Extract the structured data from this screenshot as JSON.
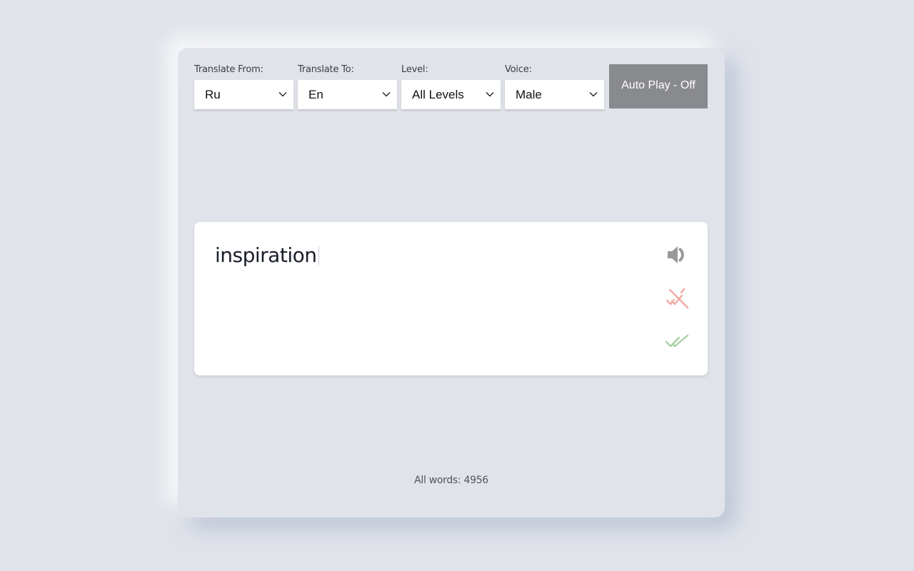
{
  "controls": {
    "from": {
      "label": "Translate From:",
      "value": "Ru"
    },
    "to": {
      "label": "Translate To:",
      "value": "En"
    },
    "level": {
      "label": "Level:",
      "value": "All Levels"
    },
    "voice": {
      "label": "Voice:",
      "value": "Male"
    },
    "autoplay_label": "Auto Play - Off"
  },
  "card": {
    "word": "inspiration",
    "icons": [
      "speaker-icon",
      "dont-know-icon",
      "know-icon"
    ]
  },
  "footer": {
    "text": "All words: 4956"
  },
  "colors": {
    "background": "#e0e3ea",
    "autoplay_button": "#898a8d",
    "speaker_icon": "#999999",
    "dont_know_icon": "#f2a8a4",
    "know_icon": "#a8d0a6"
  }
}
